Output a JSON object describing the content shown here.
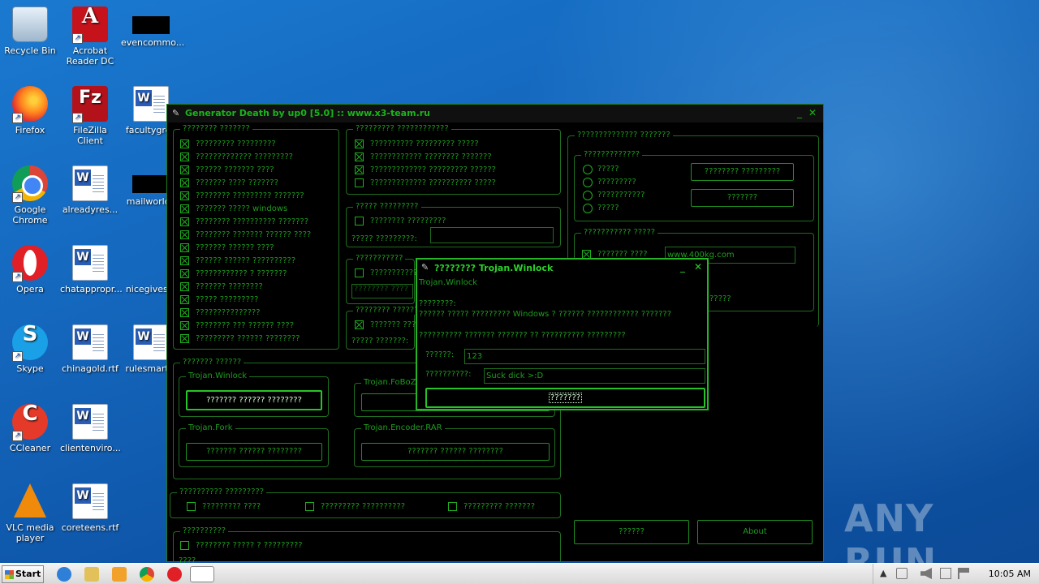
{
  "desktop": {
    "icons": [
      {
        "label": "Recycle Bin"
      },
      {
        "label": "Acrobat Reader DC"
      },
      {
        "label": "evencommo..."
      },
      {
        "label": "Firefox"
      },
      {
        "label": "FileZilla Client"
      },
      {
        "label": "facultygree"
      },
      {
        "label": "Google Chrome"
      },
      {
        "label": "alreadyres..."
      },
      {
        "label": "mailworld.j"
      },
      {
        "label": "Opera"
      },
      {
        "label": "chatappropr..."
      },
      {
        "label": "nicegives.p"
      },
      {
        "label": "Skype"
      },
      {
        "label": "chinagold.rtf"
      },
      {
        "label": "rulesmartin"
      },
      {
        "label": "CCleaner"
      },
      {
        "label": "clientenviro..."
      },
      {
        "label": "VLC media player"
      },
      {
        "label": "coreteens.rtf"
      }
    ],
    "watermark": "ANY RUN"
  },
  "app": {
    "title": "Generator Death by up0 [5.0] :: www.x3-team.ru",
    "minimize": "_",
    "close": "✕",
    "group1": {
      "title": "???????? ???????",
      "items": [
        "????????? ?????????",
        "????????????? ?????????",
        "?????? ??????? ????",
        "??????? ???? ???????",
        "???????? ????????? ???????",
        "??????? ????? windows",
        "???????? ?????????? ???????",
        "???????? ??????? ?????? ????",
        "??????? ?????? ????",
        "?????? ?????? ??????????",
        "???????????? ? ???????",
        "??????? ????????",
        "????? ?????????",
        "???????????????",
        "???????? ??? ?????? ????",
        "????????? ?????? ????????"
      ]
    },
    "group2": {
      "title": "????????? ????????????",
      "items": [
        {
          "label": "?????????? ????????? ?????",
          "checked": true
        },
        {
          "label": "???????????? ???????? ???????",
          "checked": true
        },
        {
          "label": "????????????? ????????? ??????",
          "checked": true
        },
        {
          "label": "????????????? ?????????? ?????",
          "checked": false
        }
      ]
    },
    "group3": {
      "title": "????? ?????????",
      "checkbox": "???????? ?????????",
      "field_label": "????? ?????????:"
    },
    "group4": {
      "title": "???????????",
      "checkbox": "???????????",
      "placeholder": "???????? ????"
    },
    "group5": {
      "title": "???????? ???????????",
      "checkbox": "??????? ???????",
      "field_label": "????? ???????:"
    },
    "right_top": {
      "title": "?????????????? ???????",
      "sub": {
        "title": "?????????????",
        "radios": [
          "?????",
          "?????????",
          "???????????",
          "?????"
        ],
        "btn1": "???????? ?????????",
        "btn2": "???????"
      }
    },
    "right_mid": {
      "title": "??????????? ?????",
      "checkbox": "??????? ????",
      "url": "www.400kg.com",
      "tail": "?????"
    },
    "bottom_left": {
      "title": "??????? ??????",
      "groups": [
        {
          "title": "Trojan.Winlock",
          "button": "??????? ?????? ????????"
        },
        {
          "title": "Trojan.FoBoZ",
          "button": "??"
        },
        {
          "title": "Trojan.Fork",
          "button": "??????? ?????? ????????"
        },
        {
          "title": "Trojan.Encoder.RAR",
          "button": "??????? ?????? ????????"
        }
      ]
    },
    "row_opts": {
      "title": "?????????? ?????????",
      "items": [
        "????????? ????",
        "????????? ??????????",
        "????????? ???????"
      ]
    },
    "row_last": {
      "title": "??????????",
      "checkbox": "???????? ????? ? ?????????",
      "cut": "????"
    },
    "bottom_buttons": {
      "left": "??????",
      "right": "About"
    }
  },
  "dialog": {
    "title": "???????? Trojan.Winlock",
    "subtitle": "Trojan.Winlock",
    "line1": "????????:",
    "line2": "?????? ????? ????????? Windows ? ?????? ???????????? ???????",
    "line3": "?????????? ??????? ??????? ?? ?????????? ?????????",
    "field1_label": "??????:",
    "field1_value": "123",
    "field2_label": "??????????:",
    "field2_value": "Suck dick >:D",
    "button": "???????"
  },
  "taskbar": {
    "start": "Start",
    "clock": "10:05 AM"
  }
}
